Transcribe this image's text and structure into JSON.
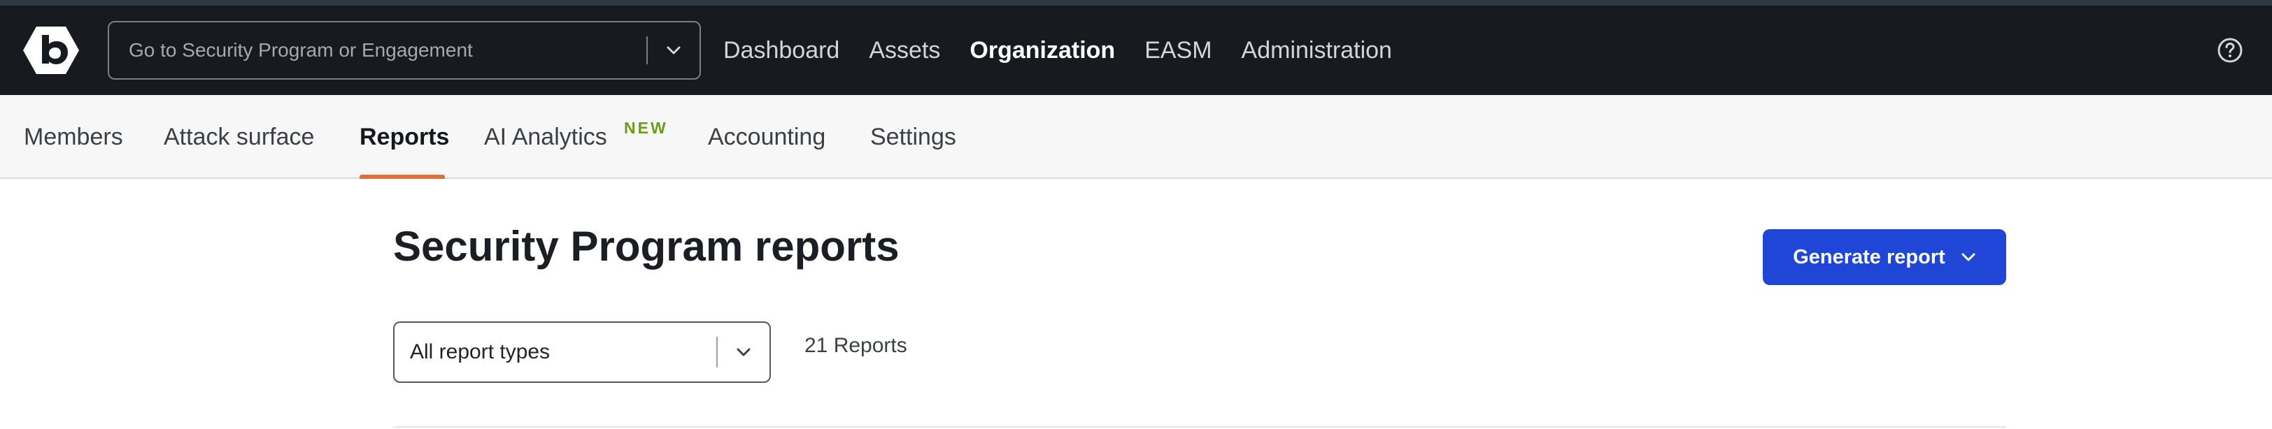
{
  "topbar": {
    "program_placeholder": "Go to Security Program or Engagement",
    "nav": [
      {
        "label": "Dashboard"
      },
      {
        "label": "Assets"
      },
      {
        "label": "Organization",
        "active": true
      },
      {
        "label": "EASM"
      },
      {
        "label": "Administration"
      }
    ]
  },
  "subnav": {
    "tabs": [
      {
        "label": "Members"
      },
      {
        "label": "Attack surface"
      },
      {
        "label": "Reports",
        "active": true
      },
      {
        "label": "AI Analytics",
        "badge": "NEW"
      },
      {
        "label": "Accounting"
      },
      {
        "label": "Settings"
      }
    ]
  },
  "main": {
    "title": "Security Program reports",
    "generate_button": "Generate report",
    "report_type_select": "All report types",
    "report_count": "21 Reports"
  },
  "colors": {
    "topbar_bg": "#171b1f",
    "accent_tab": "#e0703a",
    "primary_button": "#1f46d6",
    "new_badge": "#6d9a1f"
  },
  "icons": [
    "bugcrowd-logo-icon",
    "chevron-down-icon",
    "help-circle-icon"
  ]
}
